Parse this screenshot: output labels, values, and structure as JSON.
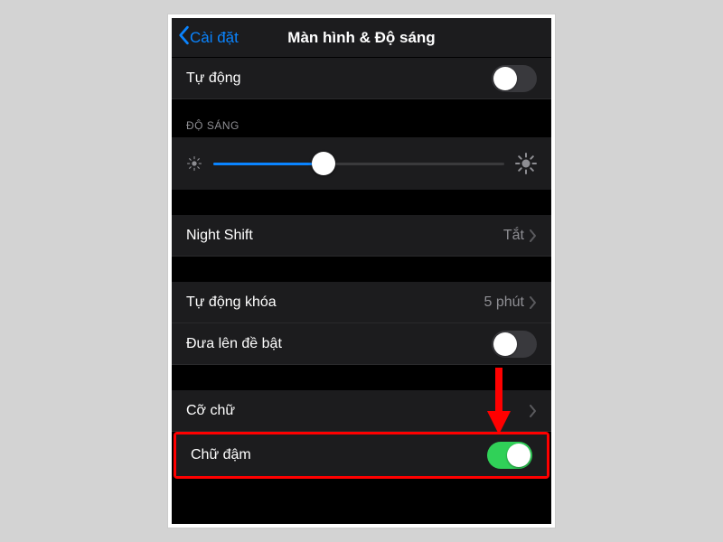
{
  "nav": {
    "back_label": "Cài đặt",
    "title": "Màn hình & Độ sáng"
  },
  "rows": {
    "auto": "Tự động",
    "brightness_header": "ĐỘ SÁNG",
    "night_shift": "Night Shift",
    "night_shift_value": "Tắt",
    "auto_lock": "Tự động khóa",
    "auto_lock_value": "5 phút",
    "raise_to_wake": "Đưa lên đề bật",
    "text_size": "Cỡ chữ",
    "bold_text": "Chữ đậm"
  },
  "toggles": {
    "auto": false,
    "raise_to_wake": false,
    "bold_text": true
  },
  "slider": {
    "brightness_pct": 38
  }
}
